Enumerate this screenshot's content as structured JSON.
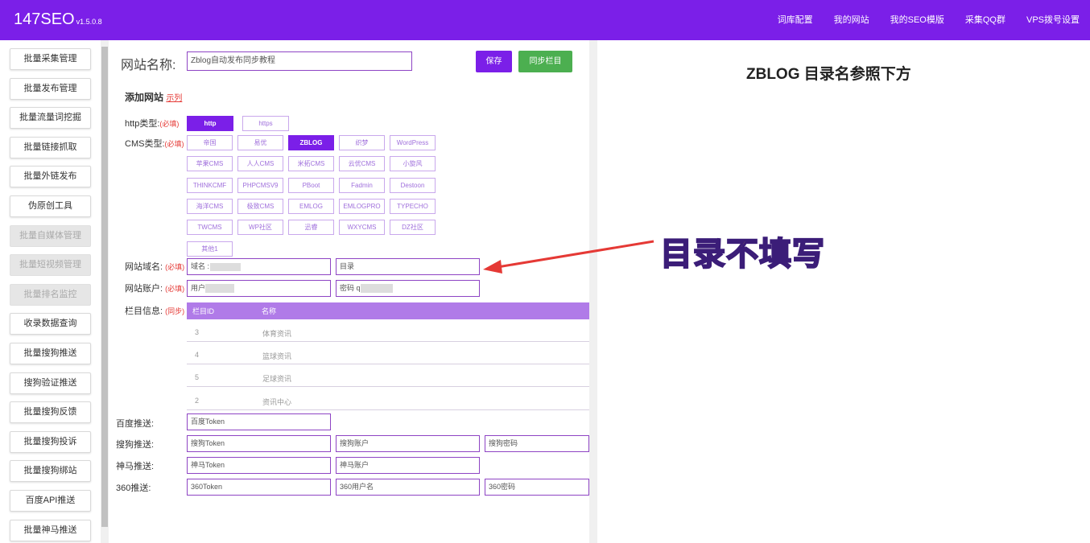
{
  "app": {
    "name": "147SEO",
    "version": "v1.5.0.8"
  },
  "topnav": [
    "词库配置",
    "我的网站",
    "我的SEO模版",
    "采集QQ群",
    "VPS拨号设置"
  ],
  "sidebar": {
    "items": [
      {
        "label": "批量采集管理",
        "disabled": false
      },
      {
        "label": "批量发布管理",
        "disabled": false
      },
      {
        "label": "批量流量词挖掘",
        "disabled": false
      },
      {
        "label": "批量链接抓取",
        "disabled": false
      },
      {
        "label": "批量外链发布",
        "disabled": false
      },
      {
        "label": "伪原创工具",
        "disabled": false
      },
      {
        "label": "批量自媒体管理",
        "disabled": true
      },
      {
        "label": "批量短视频管理",
        "disabled": true
      },
      {
        "label": "批量排名监控",
        "disabled": true
      },
      {
        "label": "收录数据查询",
        "disabled": false
      },
      {
        "label": "批量搜狗推送",
        "disabled": false
      },
      {
        "label": "搜狗验证推送",
        "disabled": false
      },
      {
        "label": "批量搜狗反馈",
        "disabled": false
      },
      {
        "label": "批量搜狗投诉",
        "disabled": false
      },
      {
        "label": "批量搜狗绑站",
        "disabled": false
      },
      {
        "label": "百度API推送",
        "disabled": false
      },
      {
        "label": "批量神马推送",
        "disabled": false
      }
    ]
  },
  "form": {
    "site_name_label": "网站名称:",
    "site_name_value": "Zblog自动发布同步教程",
    "save_label": "保存",
    "sync_label": "同步栏目",
    "add_site_label": "添加网站",
    "example_label": "示列",
    "http_label": "http类型:",
    "required": "(必填)",
    "http_options": [
      {
        "label": "http",
        "selected": true
      },
      {
        "label": "https",
        "selected": false
      }
    ],
    "cms_label": "CMS类型:",
    "cms_options": [
      {
        "label": "帝国",
        "selected": false
      },
      {
        "label": "易优",
        "selected": false
      },
      {
        "label": "ZBLOG",
        "selected": true
      },
      {
        "label": "织梦",
        "selected": false
      },
      {
        "label": "WordPress",
        "selected": false
      },
      {
        "label": "苹果CMS",
        "selected": false
      },
      {
        "label": "人人CMS",
        "selected": false
      },
      {
        "label": "米拓CMS",
        "selected": false
      },
      {
        "label": "云优CMS",
        "selected": false
      },
      {
        "label": "小旋风",
        "selected": false
      },
      {
        "label": "THINKCMF",
        "selected": false
      },
      {
        "label": "PHPCMSV9",
        "selected": false
      },
      {
        "label": "PBoot",
        "selected": false
      },
      {
        "label": "Fadmin",
        "selected": false
      },
      {
        "label": "Destoon",
        "selected": false
      },
      {
        "label": "海洋CMS",
        "selected": false
      },
      {
        "label": "极致CMS",
        "selected": false
      },
      {
        "label": "EMLOG",
        "selected": false
      },
      {
        "label": "EMLOGPRO",
        "selected": false
      },
      {
        "label": "TYPECHO",
        "selected": false
      },
      {
        "label": "TWCMS",
        "selected": false
      },
      {
        "label": "WP社区",
        "selected": false
      },
      {
        "label": "迅睿",
        "selected": false
      },
      {
        "label": "WXYCMS",
        "selected": false
      },
      {
        "label": "DZ社区",
        "selected": false
      },
      {
        "label": "其他1",
        "selected": false
      }
    ],
    "domain_label": "网站域名:",
    "domain_value": "域名 :        eo.com",
    "dir_value": "目录",
    "account_label": "网站账户:",
    "user_value": "用户名 a",
    "pass_value": "密码 q",
    "column_label": "栏目信息:",
    "sync_note": "(同步)",
    "table": {
      "headers": [
        "栏目ID",
        "名称"
      ],
      "rows": [
        [
          "3",
          "体育资讯"
        ],
        [
          "4",
          "篮球资讯"
        ],
        [
          "5",
          "足球资讯"
        ],
        [
          "2",
          "资讯中心"
        ]
      ]
    },
    "baidu_label": "百度推送:",
    "baidu_token": "百度Token",
    "sogou_label": "搜狗推送:",
    "sogou_token": "搜狗Token",
    "sogou_account": "搜狗账户",
    "sogou_password": "搜狗密码",
    "shenma_label": "神马推送:",
    "shenma_token": "神马Token",
    "shenma_account": "神马账户",
    "s360_label": "360推送:",
    "s360_token": "360Token",
    "s360_user": "360用户名",
    "s360_password": "360密码"
  },
  "right": {
    "title": "ZBLOG 目录名参照下方",
    "callout": "目录不填写"
  },
  "colors": {
    "brand": "#7b1fe8",
    "green": "#4caf50",
    "arrow": "#e53935"
  }
}
